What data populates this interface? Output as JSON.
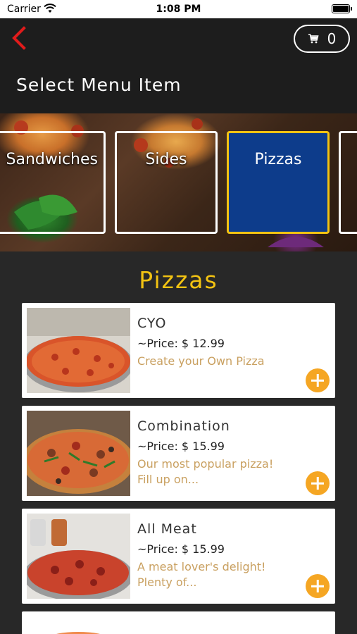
{
  "status_bar": {
    "carrier": "Carrier",
    "time": "1:08 PM"
  },
  "nav": {
    "cart_count": "0",
    "title": "Select Menu Item"
  },
  "categories": [
    {
      "label": "Sandwiches",
      "selected": false
    },
    {
      "label": "Sides",
      "selected": false
    },
    {
      "label": "Pizzas",
      "selected": true
    },
    {
      "label": "",
      "selected": false
    }
  ],
  "section": {
    "title": "Pizzas"
  },
  "items": [
    {
      "name": "CYO",
      "price": "~Price: $ 12.99",
      "description": "Create your Own Pizza"
    },
    {
      "name": "Combination",
      "price": "~Price: $ 15.99",
      "description": "Our most popular pizza! Fill up on..."
    },
    {
      "name": "All Meat",
      "price": "~Price: $ 15.99",
      "description": "A meat lover's delight! Plenty of..."
    }
  ],
  "icons": {
    "back": "chevron-left-icon",
    "cart": "cart-icon",
    "add": "plus-circle-icon",
    "wifi": "wifi-icon",
    "battery": "battery-icon"
  },
  "colors": {
    "accent_yellow": "#f3c312",
    "selected_category": "#0d3c8b",
    "add_button": "#f5a623",
    "back_red": "#e01b1b",
    "description": "#c9a060"
  }
}
